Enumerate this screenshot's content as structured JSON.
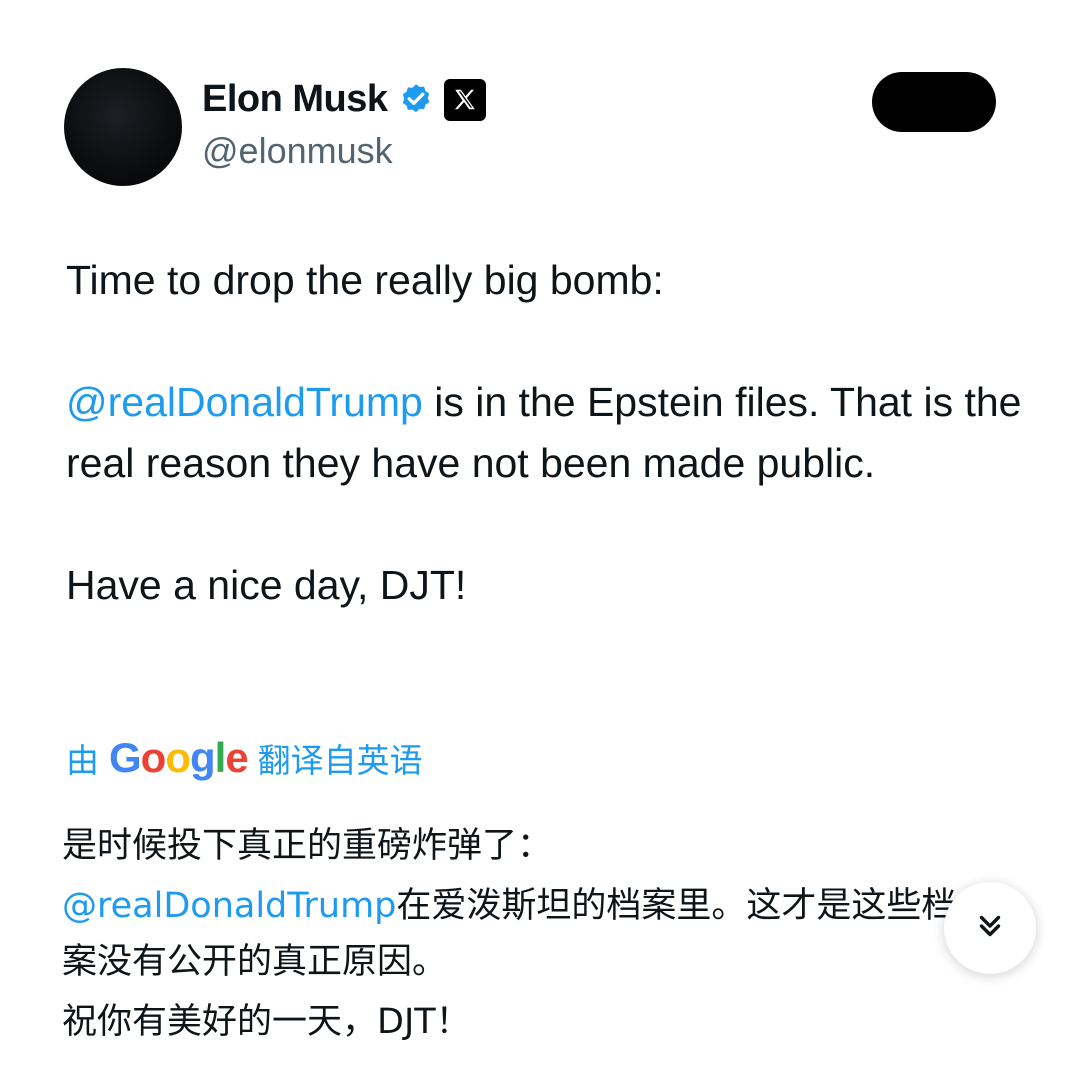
{
  "author": {
    "name": "Elon Musk",
    "handle": "@elonmusk",
    "verified_icon": "verified-badge-icon",
    "affiliation_icon": "x-logo-icon"
  },
  "tweet": {
    "line1": "Time to drop the really big bomb:",
    "mention": "@realDonaldTrump",
    "line2_rest": " is in the Epstein files. That is the real reason they have not been made public.",
    "line3": "Have a nice day, DJT!"
  },
  "translation": {
    "prefix": "由",
    "brand_letters": [
      "G",
      "o",
      "o",
      "g",
      "l",
      "e"
    ],
    "suffix": "翻译自英语",
    "line1": "是时候投下真正的重磅炸弹了：",
    "mention": "@realDonaldTrump",
    "line2_rest": "在爱泼斯坦的档案里。这才是这些档案没有公开的真正原因。",
    "line3": "祝你有美好的一天，DJT！"
  },
  "colors": {
    "link": "#1d9bf0",
    "text": "#0f1419",
    "muted": "#536471"
  },
  "controls": {
    "scroll_down_icon": "double-chevron-down-icon"
  }
}
